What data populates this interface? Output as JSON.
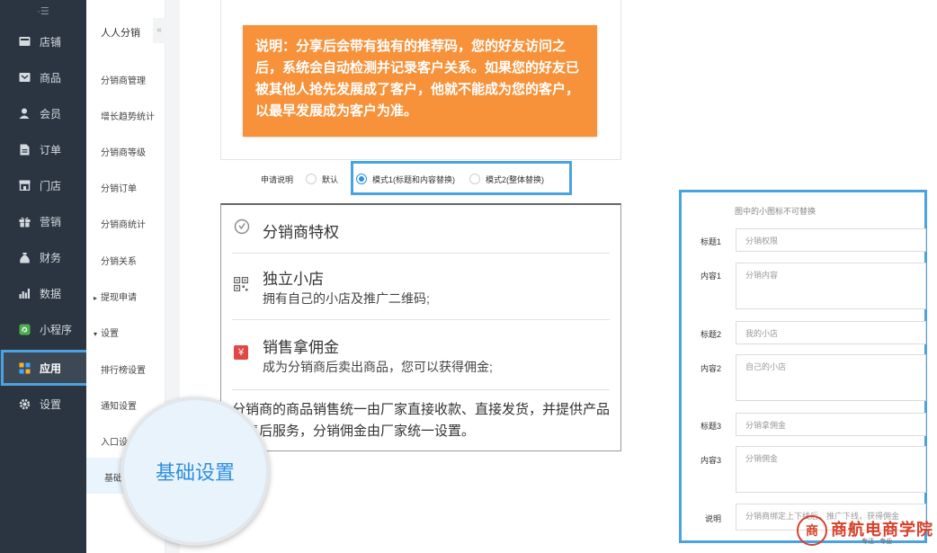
{
  "sidebar": {
    "collapse_glyph": "·☰",
    "items": [
      {
        "label": "店铺",
        "icon": "store-icon"
      },
      {
        "label": "商品",
        "icon": "goods-icon"
      },
      {
        "label": "会员",
        "icon": "member-icon"
      },
      {
        "label": "订单",
        "icon": "order-icon"
      },
      {
        "label": "门店",
        "icon": "shop-icon"
      },
      {
        "label": "营销",
        "icon": "gift-icon"
      },
      {
        "label": "财务",
        "icon": "money-bag-icon"
      },
      {
        "label": "数据",
        "icon": "bar-chart-icon"
      },
      {
        "label": "小程序",
        "icon": "mini-program-icon"
      },
      {
        "label": "应用",
        "icon": "apps-grid-icon"
      },
      {
        "label": "设置",
        "icon": "gear-icon"
      }
    ],
    "active": "应用"
  },
  "submenu": {
    "title": "人人分销",
    "collapse_glyph": "«",
    "items": [
      {
        "label": "分销商管理"
      },
      {
        "label": "增长趋势统计"
      },
      {
        "label": "分销商等级"
      },
      {
        "label": "分销订单"
      },
      {
        "label": "分销商统计"
      },
      {
        "label": "分销关系"
      },
      {
        "label": "提现申请",
        "group": true,
        "caret": "▸"
      },
      {
        "label": "设置",
        "group": true,
        "caret": "▾"
      },
      {
        "label": "排行榜设置"
      },
      {
        "label": "通知设置"
      },
      {
        "label": "入口设"
      },
      {
        "label": "基础"
      }
    ]
  },
  "notice": {
    "text": "说明：分享后会带有独有的推荐码，您的好友访问之后，系统会自动检测并记录客户关系。如果您的好友已被其他人抢先发展成了客户，他就不能成为您的客户，以最早发展成为客户为准。"
  },
  "apply": {
    "label": "申请说明",
    "options": [
      {
        "label": "默认",
        "checked": false
      },
      {
        "label": "模式1(标题和内容替换)",
        "checked": true
      },
      {
        "label": "模式2(整体替换)",
        "checked": false
      }
    ]
  },
  "preview": {
    "head_icon": "check-circle-icon",
    "head_title": "分销商特权",
    "sections": [
      {
        "icon": "qrcode-icon",
        "title": "独立小店",
        "text": "拥有自己的小店及推广二维码;"
      },
      {
        "icon": "yen-icon",
        "title": "销售拿佣金",
        "text": "成为分销商后卖出商品，您可以获得佣金;"
      }
    ],
    "footer": "分销商的商品销售统一由厂家直接收款、直接发货，并提供产品的售后服务，分销佣金由厂家统一设置。"
  },
  "magnifier": {
    "text": "基础设置"
  },
  "form": {
    "tip": "图中的小图标不可替换",
    "fields": [
      {
        "label": "标题1",
        "placeholder": "分销权限"
      },
      {
        "label": "内容1",
        "placeholder": "分销内容"
      },
      {
        "label": "标题2",
        "placeholder": "我的小店"
      },
      {
        "label": "内容2",
        "placeholder": "自己的小店"
      },
      {
        "label": "标题3",
        "placeholder": "分销拿佣金"
      },
      {
        "label": "内容3",
        "placeholder": "分销佣金"
      },
      {
        "label": "说明",
        "placeholder": "分销商绑定上下线后，推广下线，获得佣金"
      }
    ]
  },
  "logo": {
    "seal": "商",
    "name": "商航电商学院",
    "slogan": "专注 · 专业"
  },
  "colors": {
    "sidebar_bg": "#2b3541",
    "accent": "#2f8fe0",
    "notice_bg": "#f7923a",
    "highlight": "#4aa3e0",
    "logo_red": "#d8412a"
  }
}
